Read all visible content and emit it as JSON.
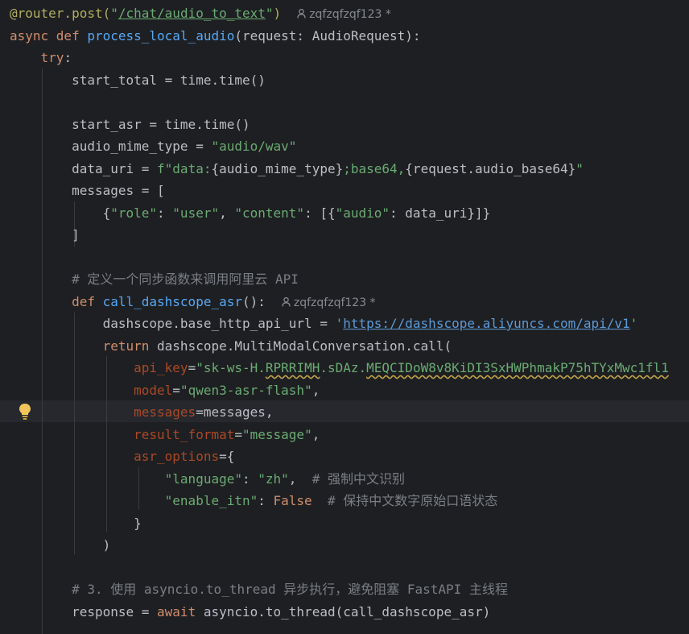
{
  "editor": {
    "author_hint": "zqfzqfzqf123 *",
    "colors": {
      "background": "#1e1f22",
      "keyword": "#cf8e6d",
      "function": "#56a8f5",
      "string": "#6aab73",
      "comment": "#7a7e85"
    },
    "lines": {
      "l1_dec": "@router.post(",
      "l1_q1": "\"",
      "l1_url": "/chat/audio_to_text",
      "l1_q2": "\"",
      "l1_end": ")",
      "l2_kw": "async def ",
      "l2_fn": "process_local_audio",
      "l2_rest": "(request: AudioRequest):",
      "l3_kw": "try",
      "l3_rest": ":",
      "l4": "start_total = time.time()",
      "l6": "start_asr = time.time()",
      "l7_a": "audio_mime_type = ",
      "l7_s": "\"audio/wav\"",
      "l8_a": "data_uri = ",
      "l8_s1": "f\"data:",
      "l8_b1": "{audio_mime_type}",
      "l8_s2": ";base64,",
      "l8_b2": "{request.audio_base64}",
      "l8_s3": "\"",
      "l9": "messages = [",
      "l10_a": "{",
      "l10_s1": "\"role\"",
      "l10_b": ": ",
      "l10_s2": "\"user\"",
      "l10_c": ", ",
      "l10_s3": "\"content\"",
      "l10_d": ": [{",
      "l10_s4": "\"audio\"",
      "l10_e": ": data_uri}]}",
      "l11": "]",
      "l13": "# 定义一个同步函数来调用阿里云 API",
      "l14_kw": "def ",
      "l14_fn": "call_dashscope_asr",
      "l14_rest": "():",
      "l15_a": "dashscope.base_http_api_url = ",
      "l15_q1": "'",
      "l15_url": "https://dashscope.aliyuncs.com/api/v1",
      "l15_q2": "'",
      "l16_kw": "return ",
      "l16_rest": "dashscope.MultiModalConversation.call(",
      "l17_k": "api_key",
      "l17_eq": "=",
      "l17_s1": "\"sk-ws-H.",
      "l17_s2": "RPRRIMH",
      "l17_s3": ".sDAz.",
      "l17_s4": "MEQCIDoW8v8KiDI3SxHWPhmakP75hTYxMwc1fl1",
      "l18_k": "model",
      "l18_eq": "=",
      "l18_s": "\"qwen3-asr-flash\"",
      "l18_e": ",",
      "l19_k": "messages",
      "l19_rest": "=messages,",
      "l20_k": "result_format",
      "l20_eq": "=",
      "l20_s": "\"message\"",
      "l20_e": ",",
      "l21_k": "asr_options",
      "l21_rest": "={",
      "l22_s1": "\"language\"",
      "l22_a": ": ",
      "l22_s2": "\"zh\"",
      "l22_b": ",  ",
      "l22_c": "# 强制中文识别",
      "l23_s1": "\"enable_itn\"",
      "l23_a": ": ",
      "l23_kw": "False",
      "l23_b": "  ",
      "l23_c": "# 保持中文数字原始口语状态",
      "l24": "}",
      "l25": ")",
      "l27": "# 3. 使用 asyncio.to_thread 异步执行，避免阻塞 FastAPI 主线程",
      "l28_a": "response = ",
      "l28_kw": "await ",
      "l28_rest": "asyncio.to_thread(call_dashscope_asr)"
    }
  }
}
